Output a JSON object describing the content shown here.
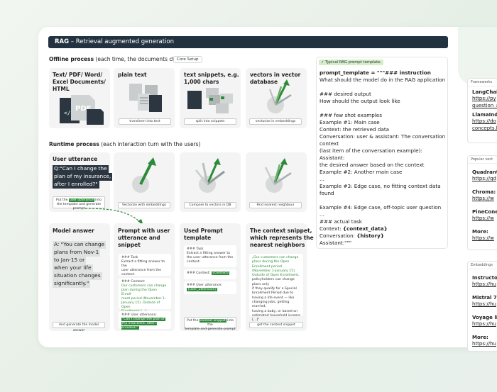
{
  "title": {
    "bold": "RAG",
    "rest": " – Retrieval augmented generation"
  },
  "offline": {
    "label_bold": "Offline process",
    "label_rest": " (each time, the documents change)",
    "chip": "Core Setup",
    "boxes": [
      {
        "title": "Text/ PDF/ Word/ Excel Documents/ HTML",
        "caption": "",
        "pdf": "PDF"
      },
      {
        "title": "plain text",
        "caption": "transform into text"
      },
      {
        "title": "text snippets, e.g. 1,000 chars",
        "caption": "split into snippets"
      },
      {
        "title": "vectors in vector database",
        "caption": "vectorize in embeddings"
      }
    ]
  },
  "runtime": {
    "label_bold": "Runtime process",
    "label_rest": " (each interaction turn with the users)",
    "user_title": "User utterance",
    "utterance": [
      "Q:\"Can I change the",
      "plan of my insurance,",
      "after I enrolled?\""
    ],
    "user_caption": [
      "Put the ",
      "user utterance",
      " into the template and generate prompt"
    ],
    "captions": [
      "Vectorize with embeddings",
      "Compare to vectors in DB",
      "Find nearest neighbour"
    ],
    "model_title": "Model answer",
    "answer": [
      "A: \"You can change",
      "plans from Nov-1",
      "to Jan-15 or",
      "when your life",
      "situation changes",
      "significantly.\""
    ],
    "model_caption": "And generate the model answer",
    "pws_title": [
      "Prompt with user",
      "utterance and",
      "snippet"
    ],
    "pws_task_head": "### Task",
    "pws_task": [
      "Extract a fitting answer to the",
      "user utterance from the",
      "context."
    ],
    "pws_ctx_head": "### Context:",
    "pws_ctx": [
      "Our customers can change",
      "plan during the Open Enroll-",
      "ment period (November 1–",
      "January 15). Outside of Open",
      "Enrollment,[...]"
    ],
    "pws_ut_head": "### User utterance:",
    "pws_ut": [
      "\"Can I change the plan of",
      "my insurance, after I enrolled?\""
    ],
    "upt_title": [
      "Used Prompt",
      "template"
    ],
    "upt_task_head": "### Task",
    "upt_task": [
      "Extract a fitting answer to",
      "the user utterance from the",
      "context."
    ],
    "upt_ctx_head": "### Context:",
    "upt_ctx_var": "{context}",
    "upt_ut_head": "### User utterance:",
    "upt_ut_var": "{user_utterance}",
    "upt_caption": [
      "Put the ",
      "context snippet",
      " into the",
      "template and generate prompt"
    ],
    "snip_title": [
      "The context snippet,",
      "which represents the",
      "nearest neighbors"
    ],
    "snip_body": [
      "„Our customers can change",
      "plans during the Open",
      "Enrollment period",
      "(November 1–January 15).",
      "Outside of Open Enrollment,",
      "policyholders can change plans only",
      "if they qualify for a Special",
      "Enrollment Period due to",
      "having a life event — like",
      "changing jobs, getting married,",
      "having a baby, or based on",
      "estimated household income",
      "[...]\""
    ],
    "snip_caption": "get the context snippet"
  },
  "prompt_panel": {
    "tag": "✓ Typical RAG prompt template.",
    "lines": [
      "prompt_template = \"\"\"### instruction",
      "What should the model do in the RAG application",
      "",
      "### desired output",
      "How should the output look like",
      "",
      "### few shot examples",
      "Example #1: Main case",
      "Context: the retrieved data",
      "Conversation: user & assistant: The conversation",
      "context",
      "(last item of the conversation example): Assistant:",
      "the desired answer based on the context",
      "Example #2: Another main case",
      "...",
      "Example #3: Edge case, no fitting context data",
      "found",
      "",
      "Example #4: Edge case, off-topic user question",
      "...",
      "### actual task"
    ],
    "ctx_prefix": "Context: ",
    "ctx_var": "{context_data}",
    "conv_prefix": "Conversation: ",
    "conv_var": "{history}",
    "assistant": "Assistant:\"\"\""
  },
  "sidebar": [
    {
      "tag": "Frameworks",
      "items": [
        {
          "name": "LangChain",
          "links": [
            "https://py",
            "question_a"
          ]
        },
        {
          "name": "LlamaInde",
          "links": [
            "https://do",
            "concepts.h"
          ]
        }
      ]
    },
    {
      "tag": "Popular vect",
      "items": [
        {
          "name": "Quadrant:",
          "links": [
            "https://qd"
          ]
        },
        {
          "name": "Chroma:",
          "links": [
            "https://w"
          ]
        },
        {
          "name": "PineCone:",
          "links": [
            "https://w"
          ]
        },
        {
          "name": "More:",
          "links": [
            "https://w"
          ]
        }
      ]
    },
    {
      "tag": "Embeddings",
      "items": [
        {
          "name": "Instructor",
          "links": [
            "https://hu"
          ]
        },
        {
          "name": "Mistral 7B",
          "links": [
            "https://hu"
          ]
        },
        {
          "name": "Voyage lite",
          "links": [
            "https://hu"
          ]
        },
        {
          "name": "More:",
          "links": [
            "https://hu"
          ]
        }
      ]
    }
  ],
  "colors": {
    "accent": "#2e8a3a",
    "dark": "#233240",
    "box": "#f3f4f3"
  }
}
